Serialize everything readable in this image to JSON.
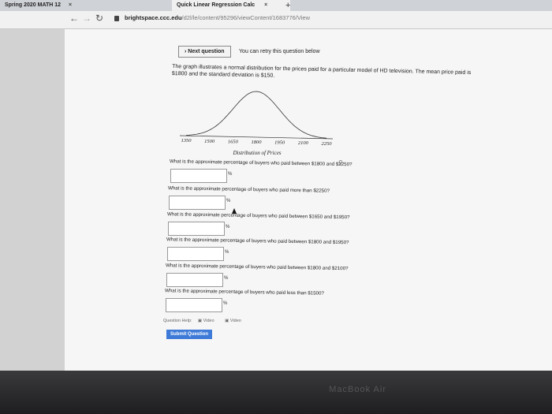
{
  "browser": {
    "tabs": [
      {
        "label": "Spring 2020 MATH 12",
        "close": "×"
      },
      {
        "label": "Quick Linear Regression Calc",
        "close": "×"
      }
    ],
    "new_tab": "+",
    "url_domain": "brightspace.ccc.edu",
    "url_path": "/d2l/le/content/95296/viewContent/1683776/View"
  },
  "header": {
    "next_question": "Next question",
    "retry_text": "You can retry this question below"
  },
  "intro": "The graph illustrates a normal distribution for the prices paid for a particular model of HD television. The mean price paid is $1800 and the standard deviation is $150.",
  "chart_data": {
    "type": "line",
    "x": [
      1350,
      1500,
      1650,
      1800,
      1950,
      2100,
      2250
    ],
    "tick_labels": [
      "1350",
      "1500",
      "1650",
      "1800",
      "1950",
      "2100",
      "2250"
    ],
    "xlabel": "Distribution of Prices",
    "mean": 1800,
    "std": 150
  },
  "questions": [
    {
      "text": "What is the approximate percentage of buyers who paid between $1800 and $2250?",
      "unit": "%",
      "value": ""
    },
    {
      "text": "What is the approximate percentage of buyers who paid more than $2250?",
      "unit": "%",
      "value": ""
    },
    {
      "text": "What is the approximate percentage of buyers who paid between $1650 and $1950?",
      "unit": "%",
      "value": ""
    },
    {
      "text": "What is the approximate percentage of buyers who paid between $1800 and $1950?",
      "unit": "%",
      "value": ""
    },
    {
      "text": "What is the approximate percentage of buyers who paid between $1800 and $2100?",
      "unit": "%",
      "value": ""
    },
    {
      "text": "What is the approximate percentage of buyers who paid less than $1500?",
      "unit": "%",
      "value": ""
    }
  ],
  "footer": {
    "help_label": "Question Help:",
    "video1": "Video",
    "video2": "Video",
    "submit": "Submit Question"
  },
  "bezel": {
    "brand": "MacBook Air"
  }
}
